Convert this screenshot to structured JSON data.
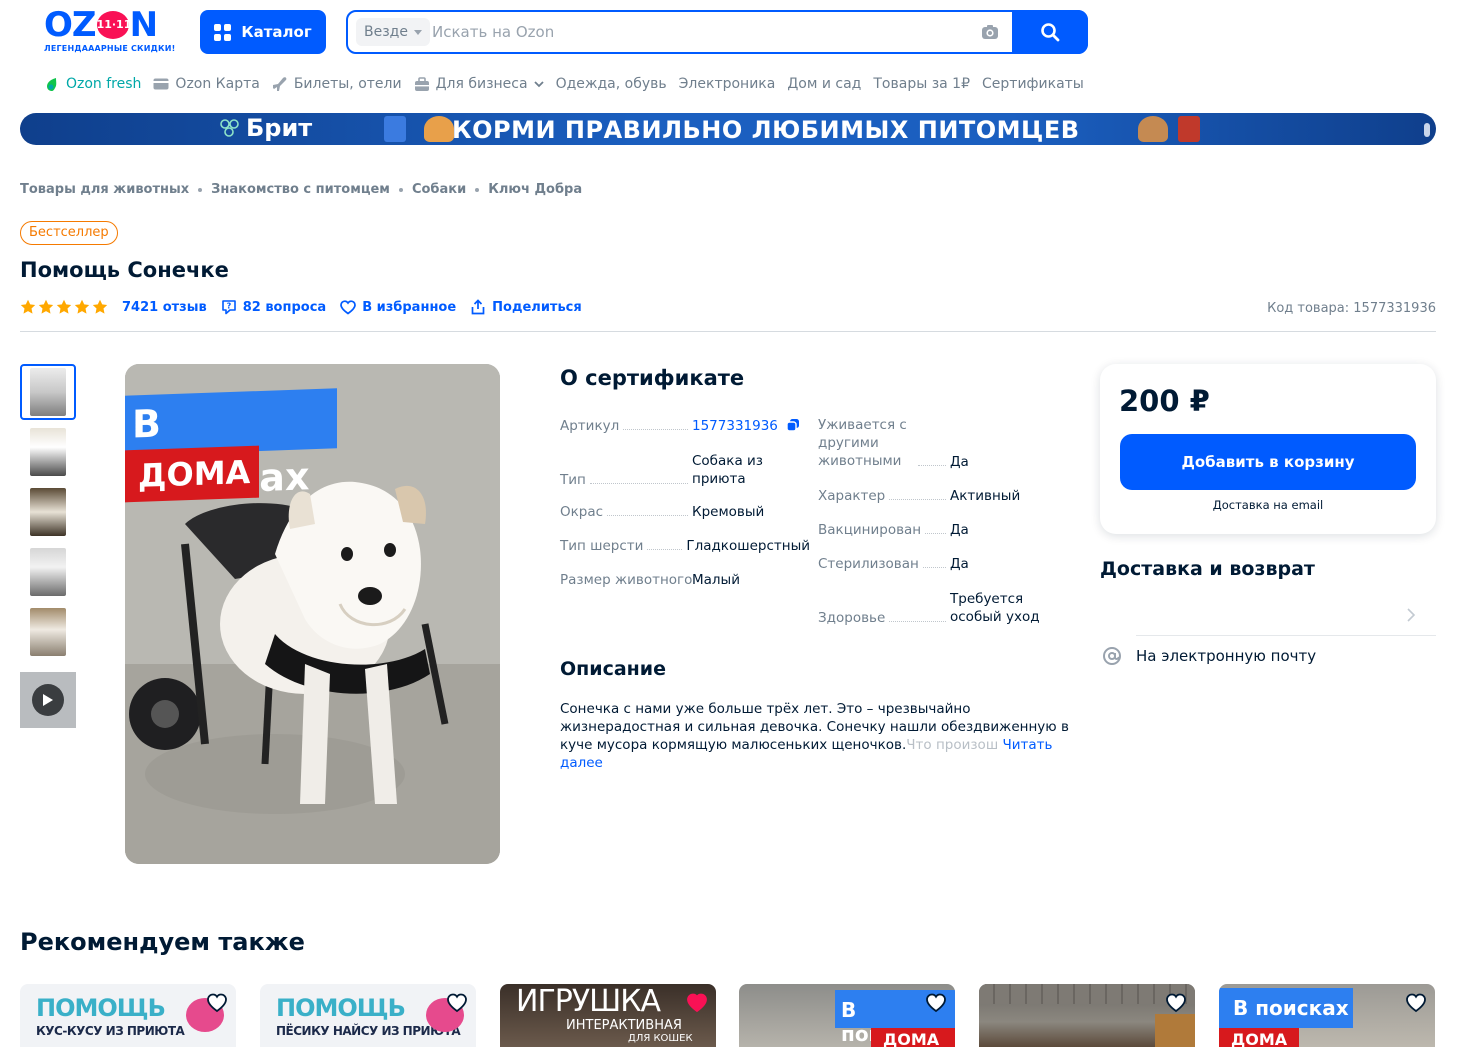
{
  "header": {
    "logo_text_left": "OZ",
    "logo_badge": "11·11",
    "logo_text_right": "N",
    "logo_tagline": "ЛЕГЕНДАААРНЫЕ СКИДКИ!",
    "catalog_label": "Каталог",
    "search_scope": "Везде",
    "search_placeholder": "Искать на Ozon",
    "nav": [
      "Ozon fresh",
      "Ozon Карта",
      "Билеты, отели",
      "Для бизнеса",
      "Одежда, обувь",
      "Электроника",
      "Дом и сад",
      "Товары за 1₽",
      "Сертификаты"
    ]
  },
  "banner": {
    "brand": "Брит",
    "slogan": "КОРМИ ПРАВИЛЬНО ЛЮБИМЫХ ПИТОМЦЕВ"
  },
  "product": {
    "breadcrumbs": [
      "Товары для животных",
      "Знакомство с питомцем",
      "Собаки",
      "Ключ Добра"
    ],
    "badge": "Бестселлер",
    "title": "Помощь Сонечке",
    "rating_stars": 5,
    "reviews": "7421 отзыв",
    "questions": "82 вопроса",
    "favorite": "В избранное",
    "share": "Поделиться",
    "code": "Код товара: 1577331936",
    "image_tag_top": "В поисках",
    "image_tag_bottom": "ДОМА"
  },
  "about": {
    "title": "О сертификате",
    "left": [
      {
        "key": "Артикул",
        "value": "1577331936"
      },
      {
        "key": "Тип",
        "value": "Собака из приюта"
      },
      {
        "key": "Окрас",
        "value": "Кремовый"
      },
      {
        "key": "Тип шерсти",
        "value": "Гладкошерстный"
      },
      {
        "key": "Размер животного",
        "value": "Малый"
      }
    ],
    "right": [
      {
        "key": "Уживается с другими животными",
        "value": "Да"
      },
      {
        "key": "Характер",
        "value": "Активный"
      },
      {
        "key": "Вакцинирован",
        "value": "Да"
      },
      {
        "key": "Стерилизован",
        "value": "Да"
      },
      {
        "key": "Здоровье",
        "value": "Требуется особый уход"
      }
    ]
  },
  "description": {
    "title": "Описание",
    "text": "Сонечка с нами уже больше трёх лет. Это – чрезвычайно жизнерадостная и сильная девочка. Сонечку нашли обездвиженную в куче мусора кормящую малюсеньких щеночков.",
    "faded": "Что произош",
    "more": "Читать далее"
  },
  "buy": {
    "price": "200 ₽",
    "cart_label": "Добавить в корзину",
    "delivery_note": "Доставка на email"
  },
  "shipping": {
    "title": "Доставка и возврат",
    "email_option": "На электронную почту"
  },
  "recommend": {
    "title": "Рекомендуем также",
    "cards": [
      {
        "line1": "ПОМОЩЬ",
        "line2": "КУС-КУСУ ИЗ ПРИЮТА"
      },
      {
        "line1": "ПОМОЩЬ",
        "line2": "ПЁСИКУ НАЙСУ ИЗ ПРИЮТА"
      },
      {
        "line1": "ИГРУШКА",
        "line2": "ИНТЕРАКТИВНАЯ",
        "line3": "ДЛЯ КОШЕК"
      },
      {
        "line1": "В поисках",
        "line2": "ДОМА"
      },
      {
        "line1": ""
      },
      {
        "line1": "В поисках",
        "line2": "ДОМА"
      }
    ]
  },
  "colors": {
    "accent": "#005bff",
    "bestseller": "#f57a00",
    "star": "#ffa800"
  }
}
